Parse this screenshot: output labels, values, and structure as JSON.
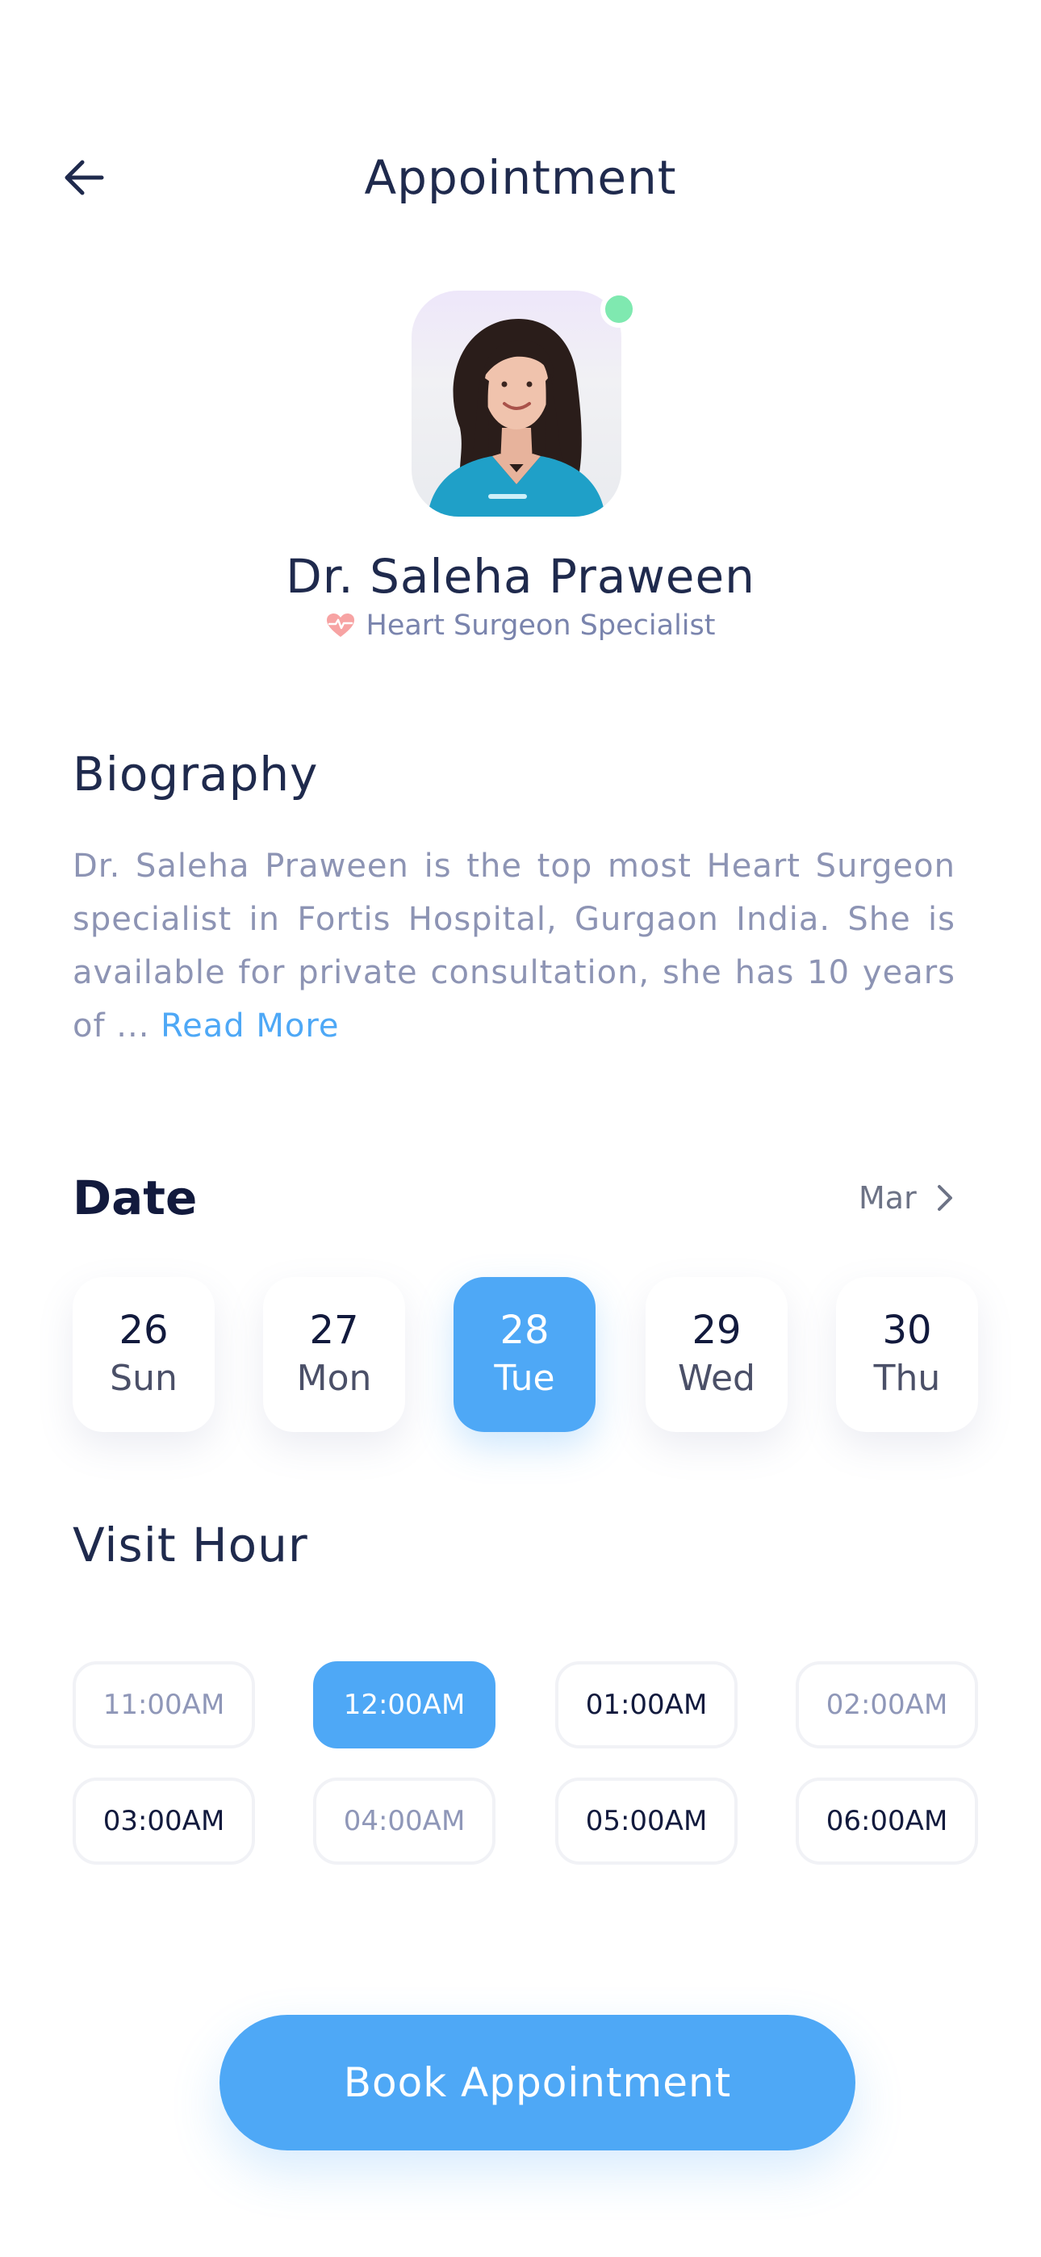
{
  "header": {
    "title": "Appointment",
    "back_icon": "arrow-left-icon"
  },
  "doctor": {
    "name": "Dr. Saleha Praween",
    "specialty": "Heart Surgeon Specialist",
    "specialty_icon": "heart-pulse-icon",
    "status": "online",
    "status_color": "#7fe9b0"
  },
  "biography": {
    "title": "Biography",
    "text": "Dr. Saleha Praween is the top most Heart Surgeon specialist in Fortis Hospital, Gurgaon India. She is available for private consultation, she has 10 years of ... ",
    "read_more": "Read More"
  },
  "date": {
    "title": "Date",
    "month": "Mar",
    "next_icon": "chevron-right-icon",
    "days": [
      {
        "num": "26",
        "day": "Sun"
      },
      {
        "num": "27",
        "day": "Mon"
      },
      {
        "num": "28",
        "day": "Tue"
      },
      {
        "num": "29",
        "day": "Wed"
      },
      {
        "num": "30",
        "day": "Thu"
      }
    ],
    "selected_index": 2
  },
  "visit_hour": {
    "title": "Visit Hour",
    "slots": [
      {
        "time": "11:00AM",
        "state": "muted"
      },
      {
        "time": "12:00AM",
        "state": "active"
      },
      {
        "time": "01:00AM",
        "state": "normal"
      },
      {
        "time": "02:00AM",
        "state": "muted"
      },
      {
        "time": "03:00AM",
        "state": "normal"
      },
      {
        "time": "04:00AM",
        "state": "muted"
      },
      {
        "time": "05:00AM",
        "state": "normal"
      },
      {
        "time": "06:00AM",
        "state": "normal"
      }
    ]
  },
  "book_button": {
    "label": "Book Appointment"
  },
  "colors": {
    "accent": "#4ea8f6",
    "title": "#1f2a4d",
    "muted_text": "#8d94b4"
  }
}
